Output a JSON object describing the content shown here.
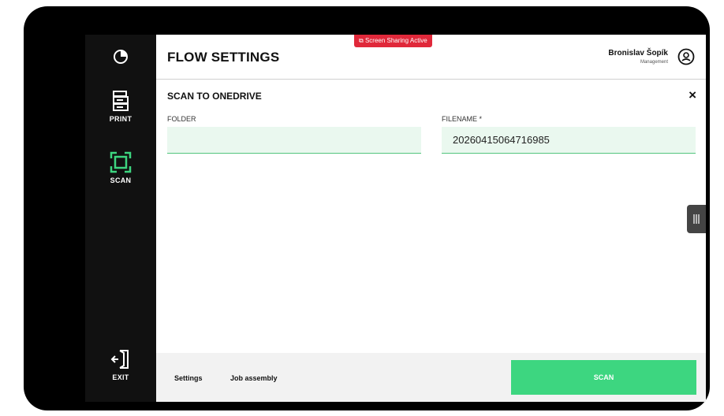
{
  "header": {
    "title": "FLOW SETTINGS",
    "sharing_badge": "Screen Sharing Active",
    "user_name": "Bronislav Šopík",
    "user_role": "Management"
  },
  "sidebar": {
    "items": [
      {
        "label": "PRINT",
        "icon": "printer-icon"
      },
      {
        "label": "SCAN",
        "icon": "scan-icon"
      }
    ],
    "exit_label": "EXIT"
  },
  "form": {
    "title": "SCAN TO ONEDRIVE",
    "close": "×",
    "folder": {
      "label": "FOLDER",
      "value": ""
    },
    "filename": {
      "label": "FILENAME *",
      "value": "20260415064716985"
    }
  },
  "footer": {
    "settings_label": "Settings",
    "job_assembly_label": "Job assembly",
    "scan_label": "SCAN"
  },
  "colors": {
    "accent": "#3dd680",
    "field_bg": "#eaf8ef",
    "sidebar": "#111111",
    "sharing_badge": "#e0283a"
  }
}
